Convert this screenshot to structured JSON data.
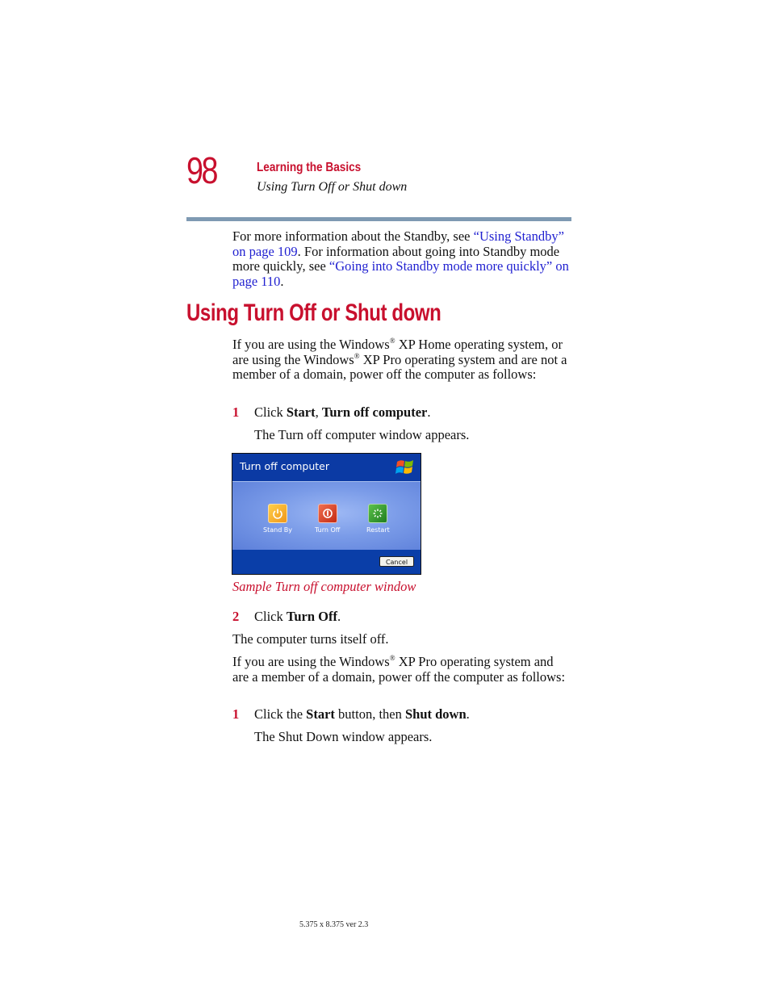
{
  "header": {
    "page_number": "98",
    "chapter": "Learning the Basics",
    "section": "Using Turn Off or Shut down"
  },
  "intro": {
    "text1": "For more information about the Standby, see ",
    "link1": "“Using Standby” on page 109",
    "text2": ". For information about going into Standby mode more quickly, see ",
    "link2": "“Going into Standby mode more quickly” on page 110",
    "text3": "."
  },
  "heading": "Using Turn Off or Shut down",
  "para1": {
    "a": "If you are using the Windows",
    "reg": "®",
    "b": " XP Home operating system, or are using the Windows",
    "c": " XP Pro operating system and are not a member of a domain, power off the computer as follows:"
  },
  "step1a": {
    "num": "1",
    "pre": "Click ",
    "b1": "Start",
    "mid": ", ",
    "b2": "Turn off computer",
    "post": "."
  },
  "step1a_result": "The Turn off computer window appears.",
  "dialog": {
    "title": "Turn off computer",
    "options": [
      {
        "label": "Stand By",
        "icon": "standby-icon",
        "color": "#f2a21c"
      },
      {
        "label": "Turn Off",
        "icon": "power-icon",
        "color": "#d9381e"
      },
      {
        "label": "Restart",
        "icon": "restart-icon",
        "color": "#2f9a2f"
      }
    ],
    "cancel_label": "Cancel"
  },
  "caption": "Sample Turn off computer window",
  "step2": {
    "num": "2",
    "pre": "Click ",
    "b1": "Turn Off",
    "post": "."
  },
  "para2": "The computer turns itself off.",
  "para3": {
    "a": "If you are using the Windows",
    "reg": "®",
    "b": " XP Pro operating system and are a member of a domain, power off the computer as follows:"
  },
  "step1b": {
    "num": "1",
    "pre": "Click the ",
    "b1": "Start",
    "mid": " button, then ",
    "b2": "Shut down",
    "post": "."
  },
  "step1b_result": "The Shut Down window appears.",
  "footer": "5.375 x 8.375 ver 2.3"
}
